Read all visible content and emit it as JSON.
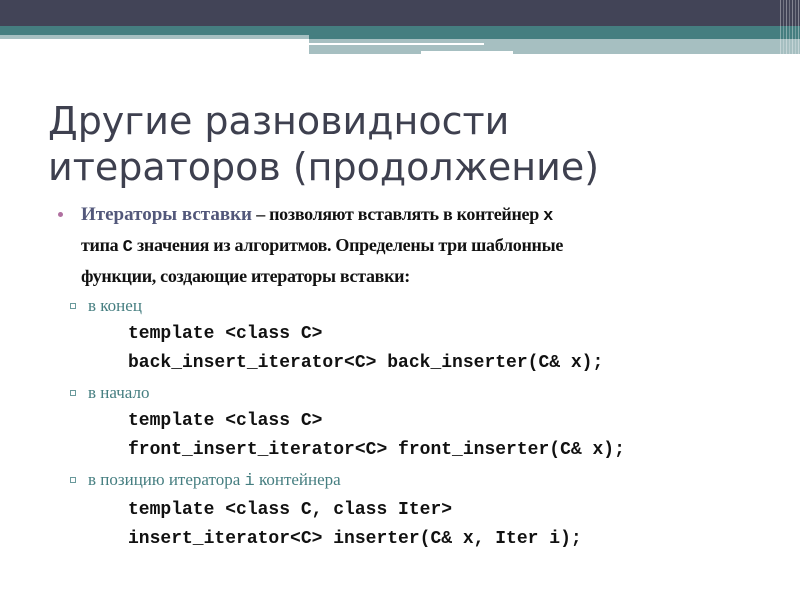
{
  "slide": {
    "title_line1": "Другие разновидности",
    "title_line2": "итераторов (продолжение)",
    "colors": {
      "header_dark": "#424457",
      "header_teal": "#457e80",
      "header_light": "#a6bfc1",
      "title": "#3e404f",
      "term": "#53587b",
      "subbullet": "#457e80"
    },
    "intro": {
      "term": "Итераторы вставки",
      "dash": " – ",
      "text_a": "позволяют вставлять в контейнер ",
      "code_x": "x",
      "text_b": "типа ",
      "code_c": "C",
      "text_c": " значения из алгоритмов. Определены три шаблонные",
      "text_d": "функции, создающие итераторы вставки:"
    },
    "items": [
      {
        "label": "в конец",
        "code": [
          "template <class C>",
          "back_insert_iterator<C> back_inserter(C& x);"
        ]
      },
      {
        "label": "в начало",
        "code": [
          "template <class C>",
          "front_insert_iterator<C> front_inserter(C& x);"
        ]
      },
      {
        "label_a": "в позицию итератора ",
        "label_code": "i",
        "label_b": " контейнера",
        "code": [
          "template <class C, class Iter>",
          "insert_iterator<C> inserter(C& x, Iter i);"
        ]
      }
    ]
  }
}
